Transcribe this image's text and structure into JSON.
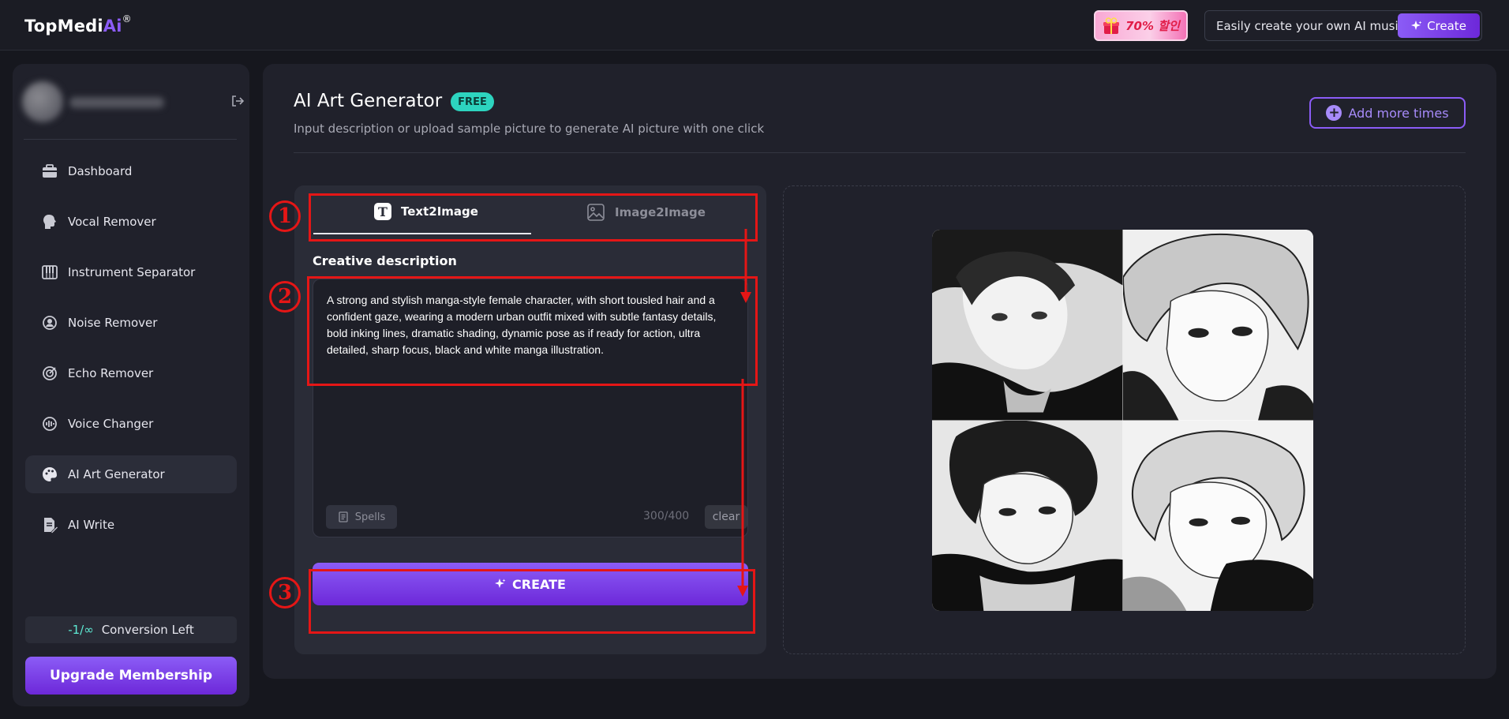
{
  "header": {
    "logo_text": "TopMedi",
    "logo_ai": "Ai",
    "logo_reg": "®",
    "promo_text": "70% 할인",
    "music_text": "Easily create your own AI music",
    "music_create_label": "Create"
  },
  "sidebar": {
    "items": [
      {
        "label": "Dashboard",
        "icon": "briefcase-icon"
      },
      {
        "label": "Vocal Remover",
        "icon": "head-icon"
      },
      {
        "label": "Instrument Separator",
        "icon": "piano-icon"
      },
      {
        "label": "Noise Remover",
        "icon": "headset-icon"
      },
      {
        "label": "Echo Remover",
        "icon": "echo-icon"
      },
      {
        "label": "Voice Changer",
        "icon": "voice-icon"
      },
      {
        "label": "AI Art Generator",
        "icon": "palette-icon",
        "active": true
      },
      {
        "label": "AI Write",
        "icon": "document-edit-icon"
      }
    ],
    "conversion_count": "-1/∞",
    "conversion_label": "Conversion Left",
    "upgrade_label": "Upgrade Membership"
  },
  "main": {
    "title": "AI Art Generator",
    "badge": "FREE",
    "subtitle": "Input description or upload sample picture to generate AI picture with one click",
    "add_more_label": "Add more times",
    "tabs": [
      {
        "label": "Text2Image",
        "active": true
      },
      {
        "label": "Image2Image",
        "active": false
      }
    ],
    "creative_label": "Creative description",
    "description": "A strong and stylish manga-style female character, with short tousled hair and a confident gaze, wearing a modern urban outfit mixed with subtle fantasy details, bold inking lines, dramatic shading, dynamic pose as if ready for action, ultra detailed, sharp focus, black and white manga illustration.",
    "spells_label": "Spells",
    "char_count": "300/400",
    "clear_label": "clear",
    "create_label": "CREATE"
  },
  "annotations": {
    "step1": "1",
    "step2": "2",
    "step3": "3",
    "color": "#e51616"
  },
  "colors": {
    "accent": "#8b5cf6",
    "badge": "#2dd4bf",
    "background": "#16171e",
    "panel": "#20212b"
  }
}
